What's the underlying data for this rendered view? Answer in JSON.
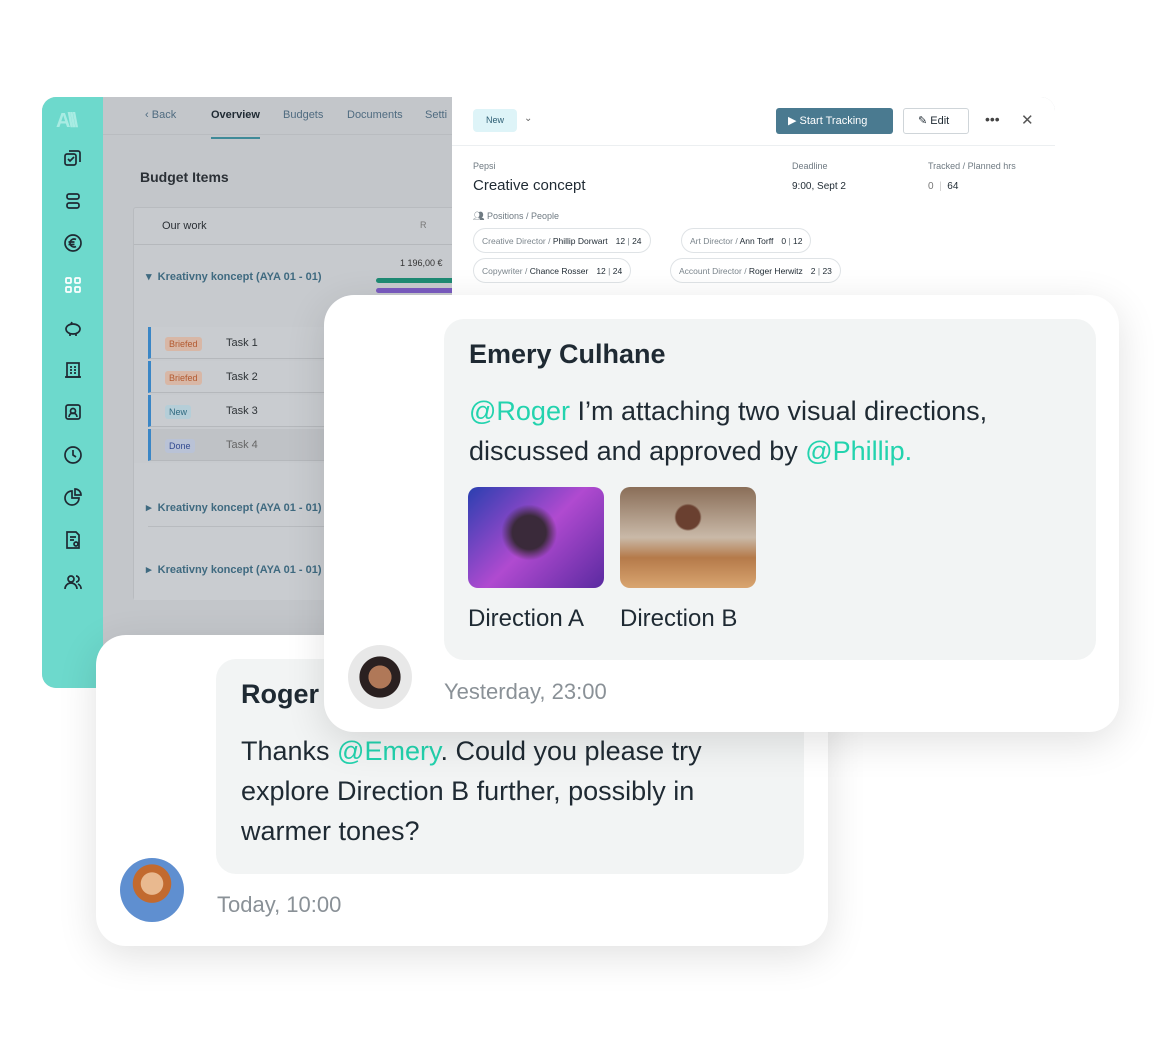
{
  "sidebar": {
    "logo": "A",
    "icons": [
      "tasks-icon",
      "layers-icon",
      "euro-icon",
      "grid-icon",
      "piggy-bank-icon",
      "building-icon",
      "contact-card-icon",
      "clock-icon",
      "pie-chart-icon",
      "invoice-icon",
      "users-icon"
    ],
    "accent": "#6dd9cc"
  },
  "nav": {
    "back": "Back",
    "tabs": [
      "Overview",
      "Budgets",
      "Documents",
      "Setti"
    ]
  },
  "budget": {
    "title": "Budget Items",
    "header": "Our work",
    "header_col": "R",
    "groups": [
      "Kreativny koncept (AYA 01 - 01)",
      "Kreativny koncept (AYA 01 - 01)",
      "Kreativny koncept (AYA 01 - 01)"
    ],
    "amount": "1 196,00 €",
    "tasks": [
      {
        "status": "Briefed",
        "name": "Task 1"
      },
      {
        "status": "Briefed",
        "name": "Task 2"
      },
      {
        "status": "New",
        "name": "Task 3"
      },
      {
        "status": "Done",
        "name": "Task 4"
      }
    ]
  },
  "panel": {
    "status": "New",
    "start": "Start Tracking",
    "edit": "Edit",
    "client": "Pepsi",
    "title": "Creative concept",
    "deadline_label": "Deadline",
    "deadline": "9:00, Sept 2",
    "hours_label": "Tracked / Planned hrs",
    "tracked": "0",
    "planned": "64",
    "positions_label": "Positions / People",
    "people": [
      {
        "role": "Creative Director / ",
        "name": "Phillip Dorwart",
        "t": "12",
        "p": "24"
      },
      {
        "role": "Art Director / ",
        "name": "Ann Torff",
        "t": "0",
        "p": "12"
      },
      {
        "role": "Copywriter / ",
        "name": "Chance Rosser",
        "t": "12",
        "p": "24"
      },
      {
        "role": "Account Director  / ",
        "name": "Roger Herwitz",
        "t": "2",
        "p": "23"
      }
    ]
  },
  "emery": {
    "name": "Emery Culhane",
    "mention1": "@Roger",
    "text1": " I’m attaching two visual directions, discussed and approved by ",
    "mention2": "@Phillip.",
    "images": [
      "Direction A",
      "Direction B"
    ],
    "time": "Yesterday, 23:00"
  },
  "roger": {
    "name": "Roger",
    "pre": "Thanks ",
    "mention": "@Emery",
    "text": ". Could you please try explore Direction B further, possibly in warmer tones?",
    "time": "Today, 10:00"
  }
}
